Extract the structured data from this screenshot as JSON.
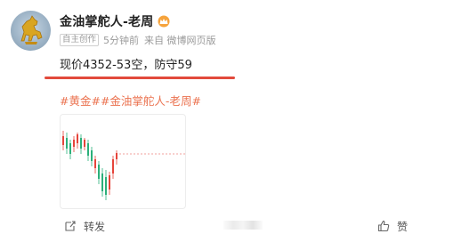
{
  "author": {
    "name": "金油掌舵人-老周",
    "badge": "crown-icon"
  },
  "meta": {
    "tag": "自主创作",
    "time": "5分钟前",
    "source": "来自 微博网页版"
  },
  "post": {
    "text": "现价4352-53空，防守59",
    "topics": [
      "#黄金#",
      "#金油掌舵人-老周#"
    ]
  },
  "actions": {
    "repost_label": "转发",
    "like_label": "赞"
  },
  "colors": {
    "topic": "#eb7350",
    "underline": "#e24a3c",
    "candle_up": "#e6443a",
    "candle_down": "#2bb07a"
  }
}
